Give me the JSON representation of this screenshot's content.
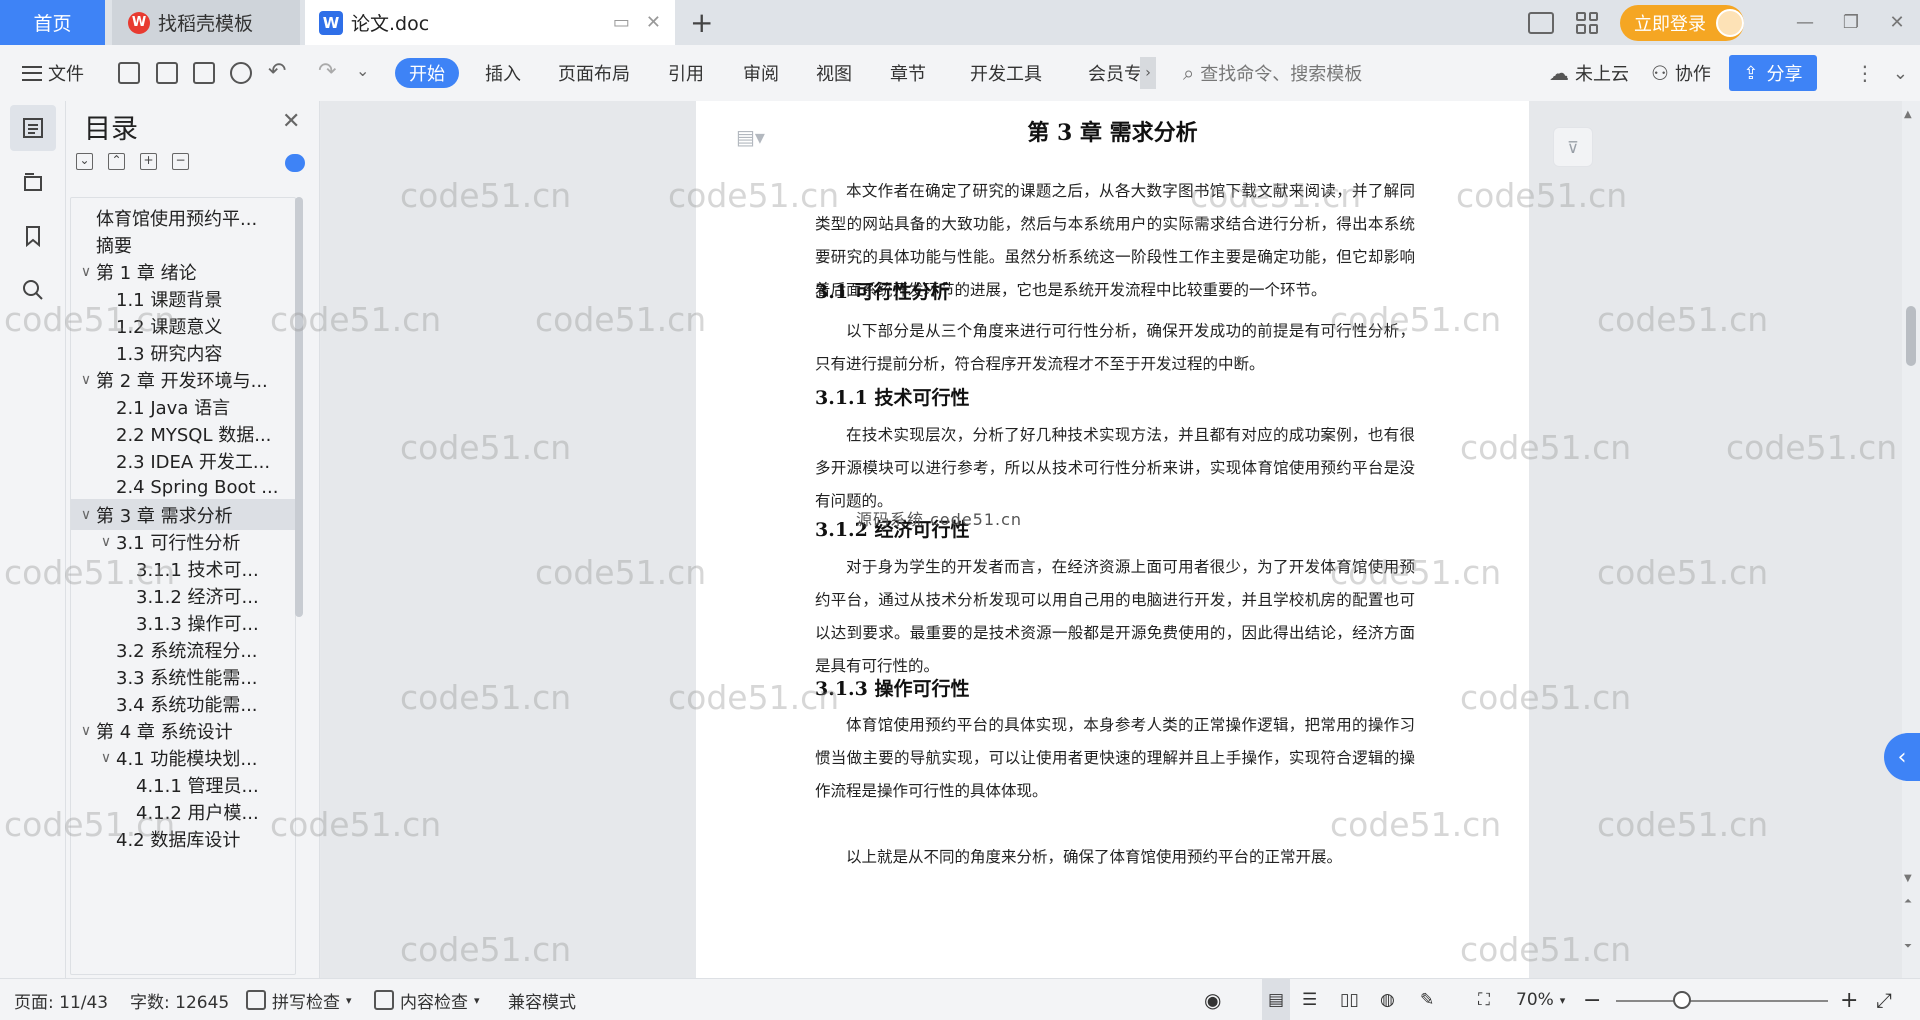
{
  "titlebar": {
    "home_tab": "首页",
    "template_tab": "找稻壳模板",
    "doc_tab": "论文.doc",
    "login_label": "立即登录"
  },
  "toolbar": {
    "file_menu": "文件",
    "tabs": [
      "开始",
      "插入",
      "页面布局",
      "引用",
      "审阅",
      "视图",
      "章节",
      "开发工具",
      "会员专"
    ],
    "search_placeholder": "查找命令、搜索模板",
    "cloud_label": "未上云",
    "collab_label": "协作",
    "share_label": "分享"
  },
  "toc": {
    "title": "目录",
    "items": [
      {
        "label": "体育馆使用预约平..."
      },
      {
        "label": "摘要"
      },
      {
        "label": "第 1 章  绪论"
      },
      {
        "label": "1.1  课题背景"
      },
      {
        "label": "1.2  课题意义"
      },
      {
        "label": "1.3  研究内容"
      },
      {
        "label": "第 2 章  开发环境与..."
      },
      {
        "label": "2.1 Java 语言"
      },
      {
        "label": "2.2 MYSQL 数据..."
      },
      {
        "label": "2.3 IDEA 开发工..."
      },
      {
        "label": "2.4 Spring Boot ..."
      },
      {
        "label": "第 3 章  需求分析"
      },
      {
        "label": "3.1  可行性分析"
      },
      {
        "label": "3.1.1  技术可..."
      },
      {
        "label": "3.1.2  经济可..."
      },
      {
        "label": "3.1.3  操作可..."
      },
      {
        "label": "3.2  系统流程分..."
      },
      {
        "label": "3.3  系统性能需..."
      },
      {
        "label": "3.4  系统功能需..."
      },
      {
        "label": "第 4 章  系统设计"
      },
      {
        "label": "4.1  功能模块划..."
      },
      {
        "label": "4.1.1  管理员..."
      },
      {
        "label": "4.1.2  用户模..."
      },
      {
        "label": "4.2  数据库设计"
      }
    ]
  },
  "document": {
    "chapter_title": "第 3 章  需求分析",
    "intro": "本文作者在确定了研究的课题之后，从各大数字图书馆下载文献来阅读，并了解同类型的网站具备的大致功能，然后与本系统用户的实际需求结合进行分析，得出本系统要研究的具体功能与性能。虽然分析系统这一阶段性工作主要是确定功能，但它却影响着后面系统开发环节的进展，它也是系统开发流程中比较重要的一个环节。",
    "s31_title": "3.1  可行性分析",
    "s31_text": "以下部分是从三个角度来进行可行性分析，确保开发成功的前提是有可行性分析，只有进行提前分析，符合程序开发流程才不至于开发过程的中断。",
    "s311_title": "3.1.1  技术可行性",
    "s311_text": "在技术实现层次，分析了好几种技术实现方法，并且都有对应的成功案例，也有很多开源模块可以进行参考，所以从技术可行性分析来讲，实现体育馆使用预约平台是没有问题的。",
    "s312_title": "3.1.2  经济可行性",
    "s312_text": "对于身为学生的开发者而言，在经济资源上面可用者很少，为了开发体育馆使用预约平台，通过从技术分析发现可以用自己用的电脑进行开发，并且学校机房的配置也可以达到要求。最重要的是技术资源一般都是开源免费使用的，因此得出结论，经济方面是具有可行性的。",
    "s313_title": "3.1.3  操作可行性",
    "s313_text": "体育馆使用预约平台的具体实现，本身参考人类的正常操作逻辑，把常用的操作习惯当做主要的导航实现，可以让使用者更快速的理解并且上手操作，实现符合逻辑的操作流程是操作可行性的具体体现。",
    "closing": "以上就是从不同的角度来分析，确保了体育馆使用预约平台的正常开展。",
    "overlay": "源码系统 code51.cn"
  },
  "watermark": "code51.cn",
  "statusbar": {
    "page": "页面: 11/43",
    "words": "字数: 12645",
    "spell": "拼写检查",
    "content_check": "内容检查",
    "compat": "兼容模式",
    "zoom": "70%"
  },
  "colors": {
    "accent": "#3e83f6",
    "login": "#f5a623"
  }
}
